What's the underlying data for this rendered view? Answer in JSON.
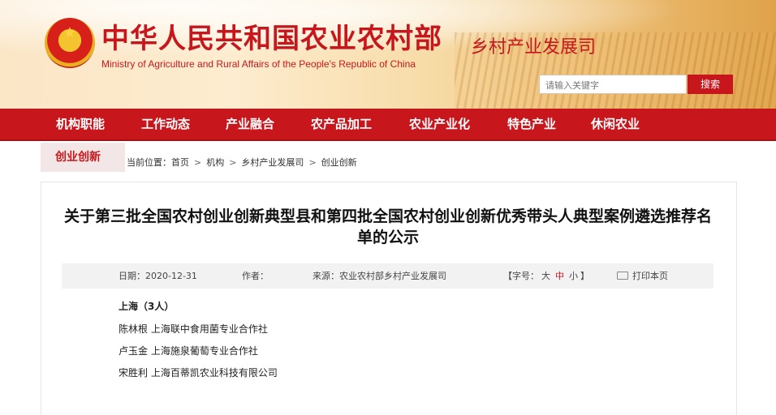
{
  "header": {
    "title_cn": "中华人民共和国农业农村部",
    "title_en": "Ministry of Agriculture and Rural Affairs of the People's Republic of China",
    "department": "乡村产业发展司",
    "search_placeholder": "请输入关键字",
    "search_button": "搜索"
  },
  "nav": {
    "items": [
      "机构职能",
      "工作动态",
      "产业融合",
      "农产品加工",
      "农业产业化",
      "特色产业",
      "休闲农业"
    ]
  },
  "section_tab": "创业创新",
  "breadcrumb": {
    "prefix": "当前位置：",
    "items": [
      "首页",
      "机构",
      "乡村产业发展司",
      "创业创新"
    ],
    "separator": ">"
  },
  "article": {
    "title": "关于第三批全国农村创业创新典型县和第四批全国农村创业创新优秀带头人典型案例遴选推荐名单的公示",
    "meta": {
      "date": "日期：2020-12-31",
      "author": "作者：",
      "source": "来源：农业农村部乡村产业发展司",
      "font_prefix": "【字号：",
      "font_large": "大",
      "font_medium": "中",
      "font_small": "小",
      "font_suffix": "】",
      "print": "打印本页"
    },
    "body": [
      "上海（3人）",
      "陈林根  上海联中食用菌专业合作社",
      "卢玉金  上海施泉葡萄专业合作社",
      "宋胜利  上海百蒂凯农业科技有限公司"
    ]
  }
}
